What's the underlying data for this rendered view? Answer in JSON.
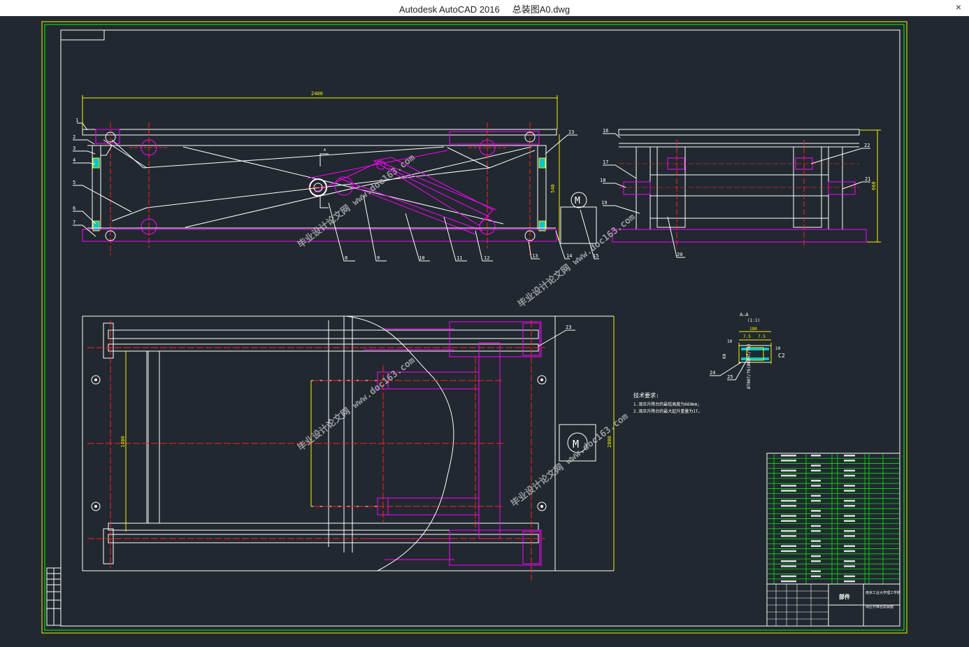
{
  "window": {
    "title": "Autodesk AutoCAD 2016     总装图A0.dwg",
    "close_glyph": "×"
  },
  "drawing": {
    "dims": {
      "width_top": "2400",
      "height_front": "540",
      "height_side": "660",
      "width_plan": "1400",
      "length_plan": "2000"
    },
    "callouts": {
      "c1": "1",
      "c2": "2",
      "c3": "3",
      "c4": "4",
      "c5": "5",
      "c6": "6",
      "c7": "7",
      "c8": "8",
      "c9": "9",
      "c10": "10",
      "c11": "11",
      "c12": "12",
      "c13": "13",
      "c14": "14",
      "c15": "15",
      "c16": "16",
      "c17": "17",
      "c18": "18",
      "c19": "19",
      "c20": "20",
      "c21": "21",
      "c22": "22",
      "c23": "23",
      "c24": "24",
      "c25": "25",
      "c23b": "23"
    },
    "motor_label": "M",
    "section": {
      "title": "A—A",
      "scale": "(1:1)",
      "dim_180": "180",
      "dim_75a": "7.5",
      "dim_75b": "7.5",
      "dim_10a": "10",
      "dim_10b": "10",
      "chamfer": "C2",
      "dim_60": "60",
      "fit": "Ø70H7/f6(Ø80H7/f6)",
      "marker": "A"
    },
    "tech_req": {
      "heading": "技术要求:",
      "line1": "1.液压升降台的最低高度为660mm;",
      "line2": "2.液压升降台的最大起升重量为1T。"
    },
    "watermark": "毕业设计论文网  www.doc163.com",
    "title_block": {
      "part_label": "部件",
      "school": "南京工业大学理工学院",
      "drawing_name": "液压升降台总装图"
    }
  }
}
